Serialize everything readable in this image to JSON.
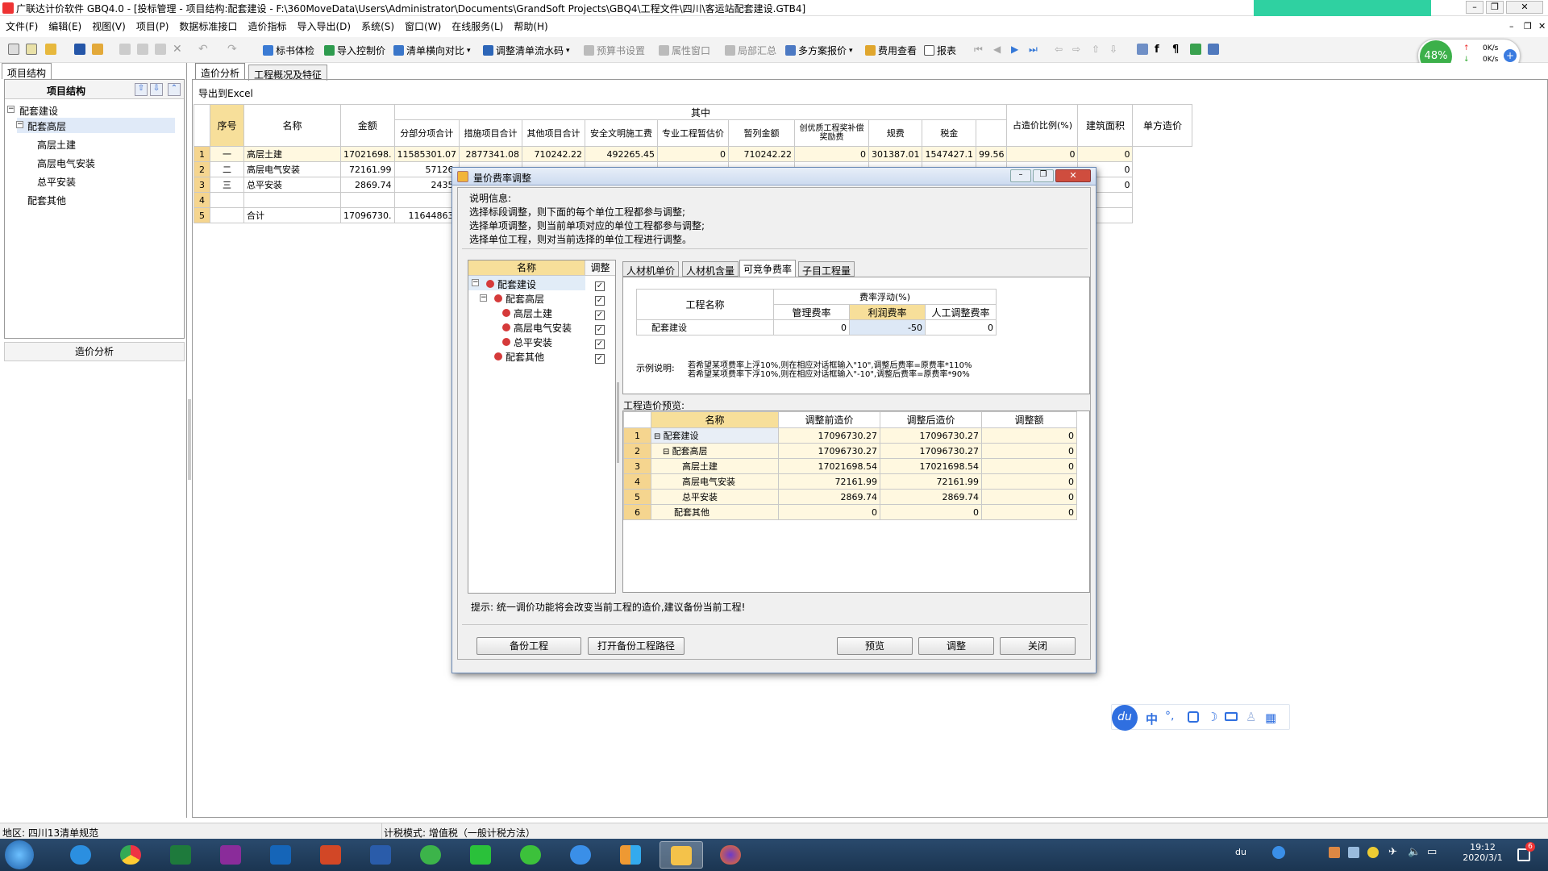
{
  "window": {
    "title": "广联达计价软件 GBQ4.0 - [投标管理 - 项目结构:配套建设 - F:\\360MoveData\\Users\\Administrator\\Documents\\GrandSoft Projects\\GBQ4\\工程文件\\四川\\客运站配套建设.GTB4]"
  },
  "menu": [
    "文件(F)",
    "编辑(E)",
    "视图(V)",
    "项目(P)",
    "数据标准接口",
    "造价指标",
    "导入导出(D)",
    "系统(S)",
    "窗口(W)",
    "在线服务(L)",
    "帮助(H)"
  ],
  "toolbar": {
    "items": [
      "标书体检",
      "导入控制价",
      "清单横向对比",
      "调整清单流水码",
      "预算书设置",
      "属性窗口",
      "局部汇总",
      "多方案报价",
      "费用查看",
      "报表"
    ]
  },
  "netmeter": {
    "percent": "48%",
    "up": "0K/s",
    "down": "0K/s"
  },
  "left": {
    "tab": "项目结构",
    "header": "项目结构",
    "tree": [
      "配套建设",
      "配套高层",
      "高层土建",
      "高层电气安装",
      "总平安装",
      "配套其他"
    ],
    "bottom_label": "造价分析"
  },
  "main": {
    "tabs": [
      "造价分析",
      "工程概况及特征"
    ],
    "export_label": "导出到Excel",
    "group_header": "其中",
    "columns": [
      "序号",
      "名称",
      "金额",
      "分部分项合计",
      "措施项目合计",
      "其他项目合计",
      "安全文明施工费",
      "专业工程暂估价",
      "暂列金额",
      "创优质工程奖补偿奖励费",
      "规费",
      "税金",
      "占造价比例(%)",
      "建筑面积",
      "单方造价"
    ],
    "rows": [
      {
        "n": "1",
        "seq": "一",
        "name": "高层土建",
        "amt": "17021698.",
        "fbfx": "11585301.07",
        "csxm": "2877341.08",
        "qtxm": "710242.22",
        "aqwm": "492265.45",
        "zygc": "0",
        "zlje": "710242.22",
        "cy": "0",
        "gf": "301387.01",
        "sj": "1547427.1",
        "bl": "99.56",
        "mj": "0",
        "df": "0"
      },
      {
        "n": "2",
        "seq": "二",
        "name": "高层电气安装",
        "amt": "72161.99",
        "fbfx": "57126.",
        "csxm": "",
        "qtxm": "",
        "aqwm": "",
        "zygc": "",
        "zlje": "",
        "cy": "",
        "gf": "",
        "sj": "",
        "bl": "",
        "mj": "",
        "df": "0"
      },
      {
        "n": "3",
        "seq": "三",
        "name": "总平安装",
        "amt": "2869.74",
        "fbfx": "2435.",
        "csxm": "",
        "qtxm": "",
        "aqwm": "",
        "zygc": "",
        "zlje": "",
        "cy": "",
        "gf": "",
        "sj": "",
        "bl": "",
        "mj": "",
        "df": "0"
      },
      {
        "n": "4",
        "seq": "",
        "name": "",
        "amt": "",
        "fbfx": "",
        "csxm": "",
        "qtxm": "",
        "aqwm": "",
        "zygc": "",
        "zlje": "",
        "cy": "",
        "gf": "",
        "sj": "",
        "bl": "",
        "mj": "",
        "df": ""
      },
      {
        "n": "5",
        "seq": "",
        "name": "合计",
        "amt": "17096730.",
        "fbfx": "11644863.",
        "csxm": "",
        "qtxm": "",
        "aqwm": "",
        "zygc": "",
        "zlje": "",
        "cy": "",
        "gf": "",
        "sj": "",
        "bl": "",
        "mj": "",
        "df": ""
      }
    ]
  },
  "dialog": {
    "title": "量价费率调整",
    "info_lines": [
      "说明信息:",
      "选择标段调整，则下面的每个单位工程都参与调整;",
      "选择单项调整，则当前单项对应的单位工程都参与调整;",
      "选择单位工程，则对当前选择的单位工程进行调整。"
    ],
    "tree_headers": [
      "名称",
      "调整"
    ],
    "tree": [
      "配套建设",
      "配套高层",
      "高层土建",
      "高层电气安装",
      "总平安装",
      "配套其他"
    ],
    "tabs": [
      "人材机单价",
      "人材机含量",
      "可竞争费率",
      "子目工程量"
    ],
    "rate": {
      "col_name": "工程名称",
      "group": "费率浮动(%)",
      "cols": [
        "管理费率",
        "利润费率",
        "人工调整费率"
      ],
      "row_name": "配套建设",
      "values": [
        "0",
        "-50",
        "0"
      ]
    },
    "example_label": "示例说明:",
    "example_lines": [
      "若希望某项费率上浮10%,则在相应对话框输入\"10\",调整后费率=原费率*110%",
      "若希望某项费率下浮10%,则在相应对话框输入\"-10\",调整后费率=原费率*90%"
    ],
    "preview_label": "工程造价预览:",
    "preview_headers": [
      "名称",
      "调整前造价",
      "调整后造价",
      "调整额"
    ],
    "preview_rows": [
      {
        "n": "1",
        "name": "配套建设",
        "before": "17096730.27",
        "after": "17096730.27",
        "diff": "0"
      },
      {
        "n": "2",
        "name": "配套高层",
        "before": "17096730.27",
        "after": "17096730.27",
        "diff": "0"
      },
      {
        "n": "3",
        "name": "高层土建",
        "before": "17021698.54",
        "after": "17021698.54",
        "diff": "0"
      },
      {
        "n": "4",
        "name": "高层电气安装",
        "before": "72161.99",
        "after": "72161.99",
        "diff": "0"
      },
      {
        "n": "5",
        "name": "总平安装",
        "before": "2869.74",
        "after": "2869.74",
        "diff": "0"
      },
      {
        "n": "6",
        "name": "配套其他",
        "before": "0",
        "after": "0",
        "diff": "0"
      }
    ],
    "hint": "提示: 统一调价功能将会改变当前工程的造价,建议备份当前工程!",
    "buttons": {
      "backup": "备份工程",
      "open_path": "打开备份工程路径",
      "preview": "预览",
      "adjust": "调整",
      "close": "关闭"
    }
  },
  "ime": {
    "logo": "du",
    "lang": "中",
    "punct": "°,"
  },
  "status": {
    "region": "地区: 四川13清单规范",
    "tax": "计税模式: 增值税（一般计税方法）"
  },
  "clock": {
    "time": "19:12",
    "date": "2020/3/1"
  },
  "tray": {
    "ime": "du",
    "notify_count": "6"
  }
}
